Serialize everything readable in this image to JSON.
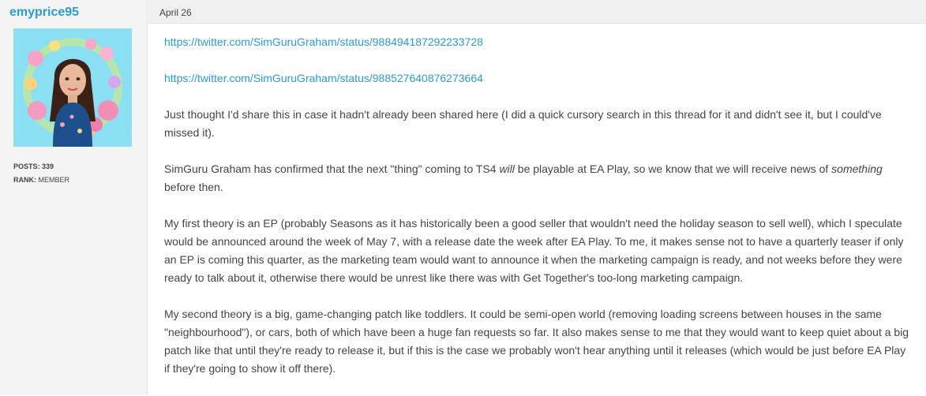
{
  "author": {
    "username": "emyprice95",
    "posts_label": "POSTS:",
    "posts_value": "339",
    "rank_label": "RANK:",
    "rank_value": "MEMBER"
  },
  "post": {
    "date": "April 26",
    "link1": "https://twitter.com/SimGuruGraham/status/988494187292233728",
    "link2": "https://twitter.com/SimGuruGraham/status/988527640876273664",
    "p1": "Just thought I'd share this in case it hadn't already been shared here (I did a quick cursory search in this thread for it and didn't see it, but I could've missed it).",
    "p2_a": "SimGuru Graham has confirmed that the next \"thing\" coming to TS4 ",
    "p2_b": "will",
    "p2_c": " be playable at EA Play, so we know that we will receive news of ",
    "p2_d": "something",
    "p2_e": " before then.",
    "p3": "My first theory is an EP (probably Seasons as it has historically been a good seller that wouldn't need the holiday season to sell well), which I speculate would be announced around the week of May 7, with a release date the week after EA Play. To me, it makes sense not to have a quarterly teaser if only an EP is coming this quarter, as the marketing team would want to announce it when the marketing campaign is ready, and not weeks before they were ready to talk about it, otherwise there would be unrest like there was with Get Together's too-long marketing campaign.",
    "p4": "My second theory is a big, game-changing patch like toddlers. It could be semi-open world (removing loading screens between houses in the same \"neighbourhood\"), or cars, both of which have been a huge fan requests so far. It also makes sense to me that they would want to keep quiet about a big patch like that until they're ready to release it, but if this is the case we probably won't hear anything until it releases (which would be just before EA Play if they're going to show it off there)."
  },
  "colors": {
    "link": "#2a9bd5",
    "sidebar_bg": "#f4f4f4",
    "avatar_bg": "#8bdff2"
  }
}
